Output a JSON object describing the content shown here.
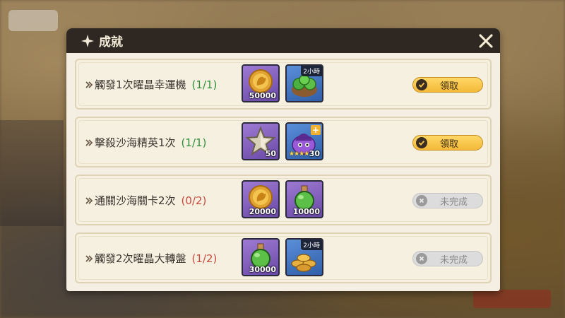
{
  "window": {
    "title": "成就"
  },
  "achievements": [
    {
      "label": "觸發1次曜晶幸運機",
      "progress": "(1/1)",
      "rewards": [
        {
          "icon": "gold-coin-icon",
          "qty": "50000",
          "tag": ""
        },
        {
          "icon": "potion-bag-icon",
          "qty": "",
          "tag": "2小時"
        }
      ],
      "button": "領取"
    },
    {
      "label": "擊殺沙海精英1次",
      "progress": "(1/1)",
      "rewards": [
        {
          "icon": "star-token-icon",
          "qty": "50",
          "tag": ""
        },
        {
          "icon": "purple-slime-pet-icon",
          "qty": "30",
          "tag": "",
          "stars": "★★★★"
        }
      ],
      "button": "領取"
    },
    {
      "label": "通關沙海關卡2次",
      "progress": "(0/2)",
      "rewards": [
        {
          "icon": "gold-coin-icon",
          "qty": "20000",
          "tag": ""
        },
        {
          "icon": "green-potion-icon",
          "qty": "10000",
          "tag": ""
        }
      ],
      "button": "未完成"
    },
    {
      "label": "觸發2次曜晶大轉盤",
      "progress": "(1/2)",
      "rewards": [
        {
          "icon": "green-potion-icon",
          "qty": "30000",
          "tag": ""
        },
        {
          "icon": "coin-pile-icon",
          "qty": "",
          "tag": "2小時"
        }
      ],
      "button": "未完成"
    }
  ],
  "colors": {
    "header": "#2e2722",
    "progress_complete": "#2e8f3a",
    "progress_incomplete": "#c84a3f",
    "claim_button": "#f3b938"
  }
}
